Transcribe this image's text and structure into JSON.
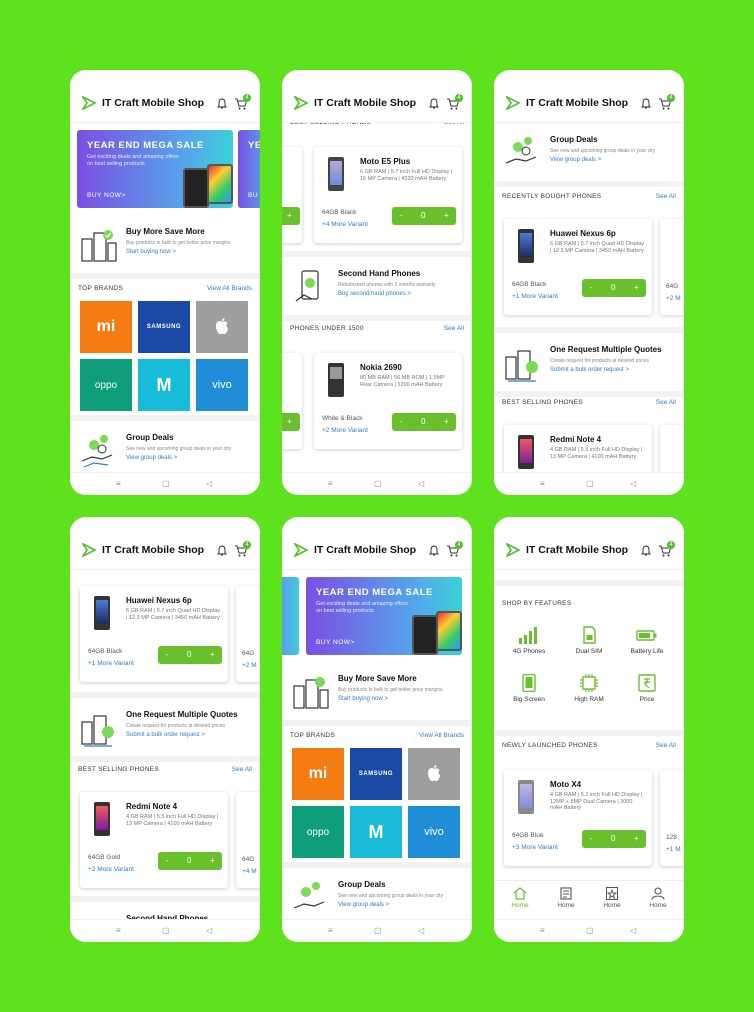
{
  "app": {
    "title": "IT Craft Mobile Shop",
    "cart_count": "4",
    "accent": "#69c02c",
    "link_color": "#2a7fd4",
    "background": "#5ee21d"
  },
  "banner": {
    "title": "YEAR END MEGA SALE",
    "subtitle": "Get exciting deals and amazing offers on best selling products",
    "cta": "BUY NOW>",
    "peek_title": "YE",
    "peek_cta": "BU"
  },
  "promos": {
    "bulk": {
      "title": "Buy More Save More",
      "subtitle": "Buy products in bulk to get better price margins",
      "link": "Start buying now >"
    },
    "group": {
      "title": "Group Deals",
      "subtitle": "See new and upcoming group deals in your city",
      "link": "View group deals >"
    },
    "second_hand": {
      "title": "Second Hand Phones",
      "subtitle": "Refurbished phones with 3 months warranty",
      "link": "Buy second hand phones >"
    },
    "quotes": {
      "title": "One Request Multiple Quotes",
      "subtitle": "Create request for products at desired prices",
      "link": "Submit a bulk order request >"
    }
  },
  "brands": {
    "header": "TOP BRANDS",
    "see_all": "View All Brands",
    "items": [
      {
        "name": "Mi",
        "label": "mi",
        "color": "#f57c10"
      },
      {
        "name": "Samsung",
        "label": "SAMSUNG",
        "color": "#1b4aa6"
      },
      {
        "name": "Apple",
        "label": "",
        "color": "#9e9e9e"
      },
      {
        "name": "Oppo",
        "label": "oppo",
        "color": "#0e9e7a"
      },
      {
        "name": "Motorola",
        "label": "M",
        "color": "#18bbd8"
      },
      {
        "name": "Vivo",
        "label": "vivo",
        "color": "#1f8ed6"
      }
    ]
  },
  "sections": {
    "best_selling": "BEST SELLING PHONES",
    "under_1500": "PHONES UNDER 1500",
    "recently_bought": "RECENTLY BOUGHT PHONES",
    "shop_by_features": "SHOP BY FEATURES",
    "newly_launched": "NEWLY LAUNCHED PHONES",
    "see_all": "See All"
  },
  "products": {
    "moto_e5": {
      "name": "Moto E5 Plus",
      "specs": "6 GB RAM | 5.7 inch Full HD Display | 16 MP Camera | 4320 mAH Battery",
      "color": "64GB Black",
      "variants": "+4 More Variant",
      "qty": "0"
    },
    "nokia": {
      "name": "Nokia 2690",
      "specs": "80 MB RAM | 56 MB ROM | 1.5MP Rear Camera | 1200 mAH Battery",
      "color": "White & Black",
      "variants": "+2 More Variant",
      "qty": "0"
    },
    "nexus": {
      "name": "Huawei Nexus 6p",
      "specs": "6 GB RAM | 5.7 inch Quad HD Display | 12.3 MP Camera | 3450 mAH Battery",
      "color": "64GB Black",
      "variants": "+1 More Variant",
      "qty": "0"
    },
    "nexus4": {
      "name": "Huawei Nexus 6p",
      "specs": "6 GB RAM | 5.7 inch Quad HD Display | 12.3 MP Camera | 3450 mAH Battery",
      "color": "64GB Black",
      "variants": "+1 More Variant",
      "qty": "0"
    },
    "redmi": {
      "name": "Redmi Note 4",
      "specs": "4 GB RAM | 5.5 inch Full HD Display | 13 MP Camera | 4100 mAH Battery",
      "color": "64GB Gold",
      "variants": "+2 More Variant",
      "qty": "0"
    },
    "redmi_top": {
      "name": "Redmi Note 4",
      "specs": "4 GB RAM | 5.5 inch Full HD Display | 13 MP Camera | 4100 mAH Battery"
    },
    "moto_x4": {
      "name": "Moto X4",
      "specs": "4 GB RAM | 5.2 inch Full HD Display | 12MP + 8MP Dual Camera | 3000 mAH Battery",
      "color": "64GB Blue",
      "variants": "+3 More Variant",
      "qty": "0"
    },
    "peek_color": "64G",
    "peek_variant_a": "+2 M",
    "peek_variant_b": "+4 M",
    "peek_variant_c": "+1 M",
    "peek_color_b": "128",
    "peek_a": "+4",
    "peek_b": "+2",
    "peek_color_c": "0"
  },
  "features": [
    {
      "label": "4G Phones",
      "icon": "signal-icon"
    },
    {
      "label": "Dual SIM",
      "icon": "sim-icon"
    },
    {
      "label": "Battery Life",
      "icon": "battery-icon"
    },
    {
      "label": "Big Screen",
      "icon": "screen-icon"
    },
    {
      "label": "High RAM",
      "icon": "chip-icon"
    },
    {
      "label": "Price",
      "icon": "price-icon"
    }
  ],
  "bottom_nav": [
    {
      "label": "Home",
      "icon": "home-icon"
    },
    {
      "label": "Home",
      "icon": "orders-icon"
    },
    {
      "label": "Home",
      "icon": "star-icon"
    },
    {
      "label": "Home",
      "icon": "profile-icon"
    }
  ],
  "system_nav": {
    "menu": "≡",
    "home": "▢",
    "back": "◁"
  }
}
